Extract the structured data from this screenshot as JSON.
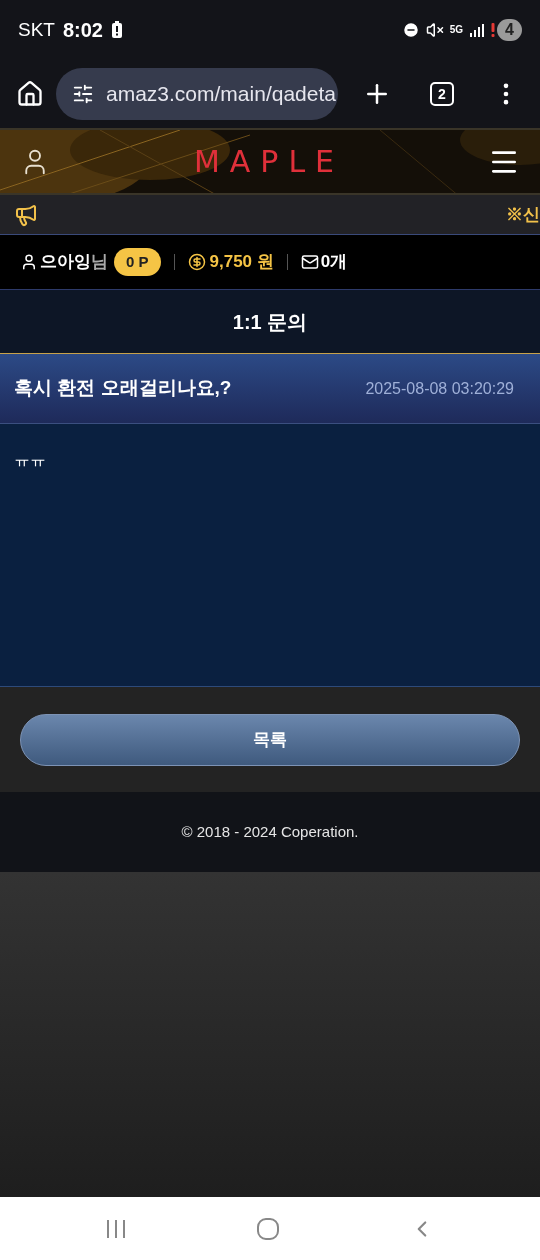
{
  "status_bar": {
    "carrier": "SKT",
    "time": "8:02",
    "network": "5G",
    "notification_count": "4"
  },
  "browser": {
    "url": "amaz3.com/main/qadeta",
    "tab_count": "2"
  },
  "header": {
    "logo": "MAPLE"
  },
  "notice": {
    "text": "※신"
  },
  "user_bar": {
    "username": "으아잉",
    "suffix": "님",
    "points": "0 P",
    "balance": "9,750 원",
    "messages": "0개"
  },
  "page_title": "1:1 문의",
  "post": {
    "title": "혹시 환전 오래걸리나요,?",
    "date": "2025-08-08 03:20:29",
    "body": "ㅠㅠ"
  },
  "list_button": "목록",
  "footer": "© 2018 - 2024 Coperation."
}
